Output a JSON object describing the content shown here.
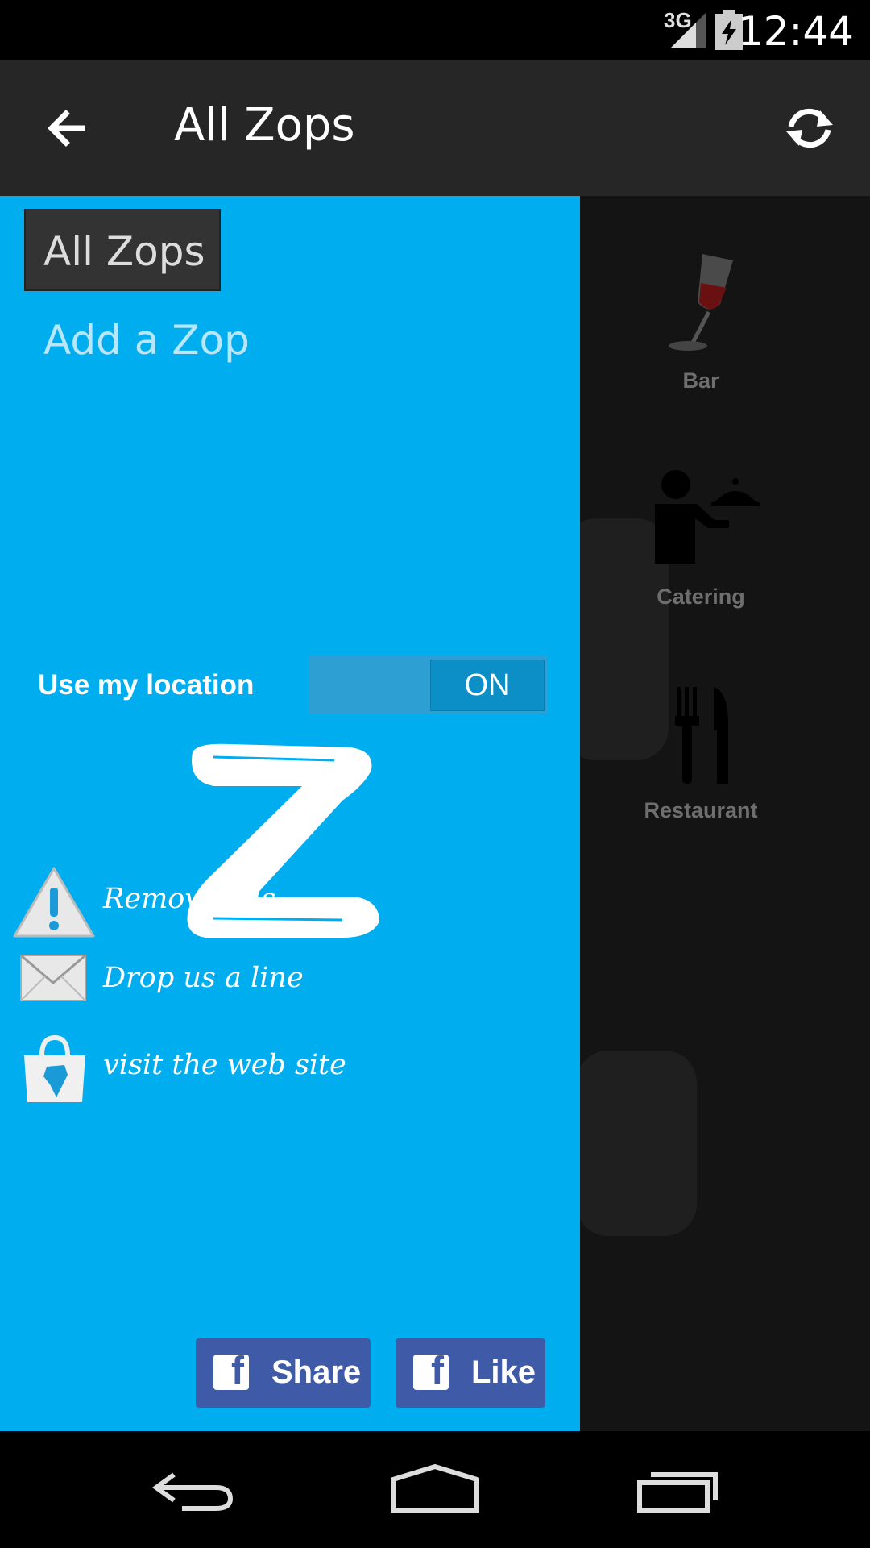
{
  "status_bar": {
    "network": "3G",
    "time": "12:44"
  },
  "action_bar": {
    "title": "All Zops"
  },
  "categories": [
    {
      "label": "Bar",
      "icon": "wine-glass-icon"
    },
    {
      "label": "Catering",
      "icon": "waiter-icon"
    },
    {
      "label": "Restaurant",
      "icon": "fork-knife-icon"
    }
  ],
  "drawer": {
    "items": [
      {
        "label": "All Zops",
        "selected": true
      },
      {
        "label": "Add a Zop",
        "selected": false
      }
    ],
    "location": {
      "label": "Use my location",
      "toggle_state": "ON"
    },
    "links": [
      {
        "label": "Remove ads",
        "icon": "warning-icon"
      },
      {
        "label": "Drop us a line",
        "icon": "envelope-icon"
      },
      {
        "label": "visit the web site",
        "icon": "shopping-bag-icon"
      }
    ],
    "share_label": "Share",
    "like_label": "Like"
  },
  "colors": {
    "drawer_bg": "#00adef",
    "action_bar": "#262626",
    "facebook": "#3f5ba7"
  }
}
